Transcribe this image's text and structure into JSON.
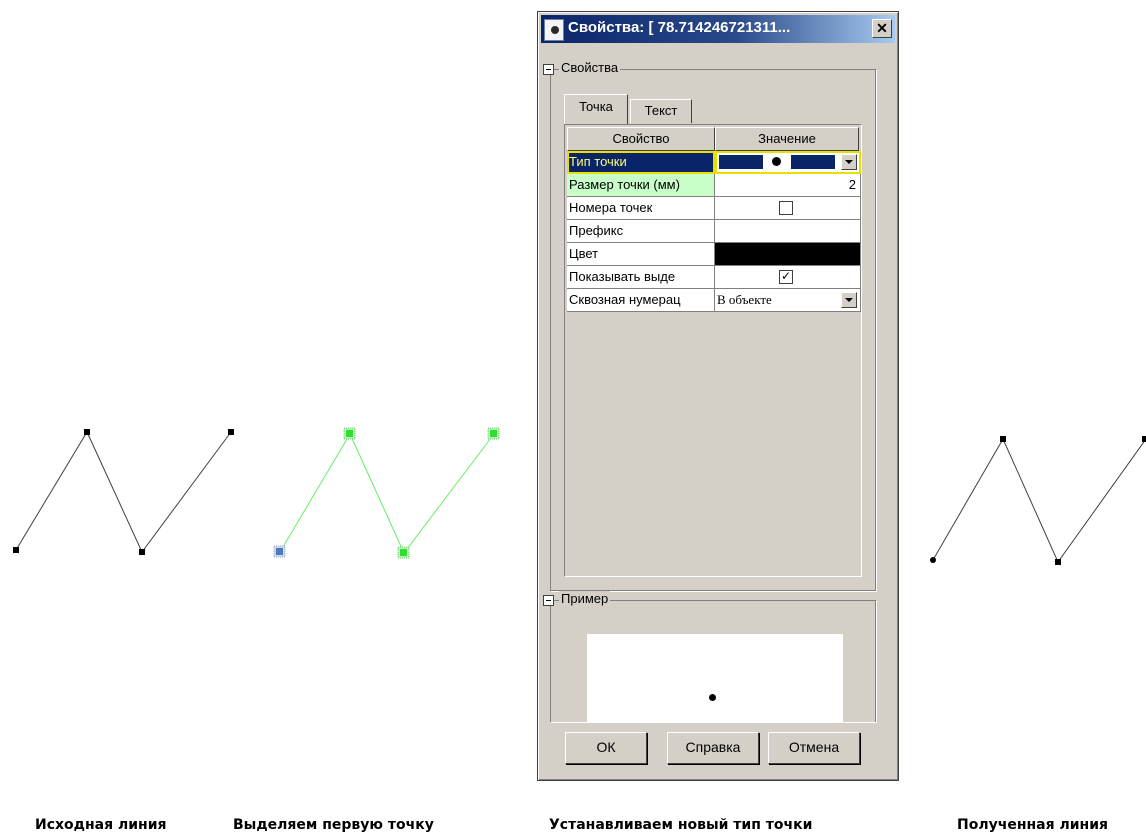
{
  "dialog": {
    "title": "Свойства: [ 78.714246721311...",
    "close_glyph": "✕",
    "group_properties": "Свойства",
    "tabs": [
      {
        "label": "Точка",
        "selected": true
      },
      {
        "label": "Текст",
        "selected": false
      }
    ],
    "grid_headers": {
      "property": "Свойство",
      "value": "Значение"
    },
    "rows": [
      {
        "name": "Тип точки",
        "value": "",
        "kind": "point-type-combo",
        "selected": true
      },
      {
        "name": "Размер точки (мм)",
        "value": "2",
        "kind": "number"
      },
      {
        "name": "Номера точек",
        "value": "",
        "kind": "checkbox",
        "checked": false
      },
      {
        "name": "Префикс",
        "value": "",
        "kind": "text"
      },
      {
        "name": "Цвет",
        "value": "",
        "kind": "color",
        "color": "#000000"
      },
      {
        "name": "Показывать выде",
        "value": "",
        "kind": "checkbox",
        "checked": true
      },
      {
        "name": "Сквозная нумерац",
        "value": "В объекте",
        "kind": "combo"
      }
    ],
    "group_example": "Пример",
    "buttons": {
      "ok": "ОК",
      "help": "Справка",
      "cancel": "Отмена"
    }
  },
  "captions": {
    "original": "Исходная линия",
    "select": "Выделяем первую  точку",
    "set_type": "Устанавливаем новый тип точки",
    "result": "Полученная линия"
  },
  "colors": {
    "selection": "#0a246a",
    "highlight_row": "#c8ffc8",
    "selected_line": "#66ee66",
    "selected_point": "#4a7aba"
  }
}
